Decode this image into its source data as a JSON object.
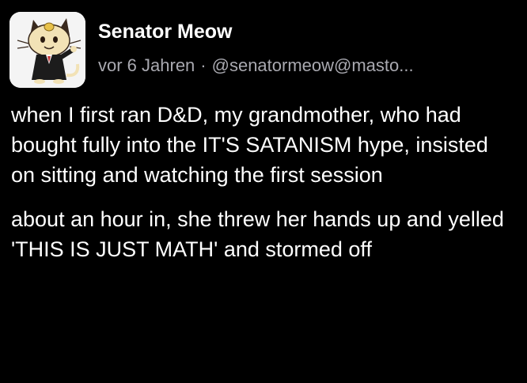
{
  "post": {
    "author_name": "Senator Meow",
    "timestamp": "vor 6 Jahren",
    "separator": "·",
    "handle": "@senatormeow@masto...",
    "avatar_icon": "meowth-in-suit-avatar",
    "paragraphs": [
      "when I first ran D&D, my grandmother, who had bought fully into the IT'S SATANISM hype, insisted on sitting and watching the first session",
      "about an hour in, she threw her hands up and yelled 'THIS IS JUST MATH' and stormed off"
    ]
  },
  "colors": {
    "background": "#000000",
    "text": "#ffffff",
    "meta": "#a9a9b0"
  }
}
